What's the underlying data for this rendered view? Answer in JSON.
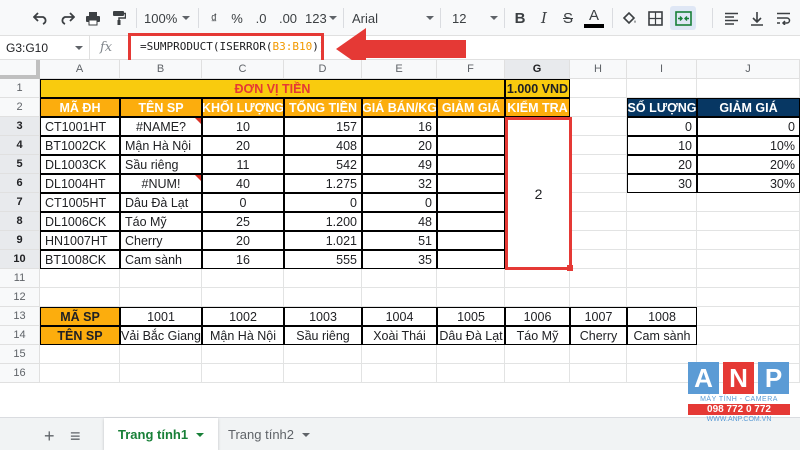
{
  "toolbar": {
    "zoom": "100%",
    "currency": "₫",
    "percent": "%",
    "dec_decrease": ".0",
    "dec_increase": ".00",
    "more_formats": "123",
    "font": "Arial",
    "font_size": "12",
    "bold": "B",
    "italic": "I",
    "strike": "S",
    "text_color": "A"
  },
  "formula_bar": {
    "name_box": "G3:G10",
    "fx": "fx",
    "formula_prefix": "=SUMPRODUCT(ISERROR(",
    "formula_ref": "B3:B10",
    "formula_suffix": "))"
  },
  "columns": [
    "A",
    "B",
    "C",
    "D",
    "E",
    "F",
    "G",
    "H",
    "I",
    "J"
  ],
  "rows": [
    "1",
    "2",
    "3",
    "4",
    "5",
    "6",
    "7",
    "8",
    "9",
    "10",
    "11",
    "12",
    "13",
    "14",
    "15",
    "16"
  ],
  "title": {
    "label": "ĐƠN VỊ TIỀN",
    "unit": "1.000 VND"
  },
  "headers": [
    "MÃ ĐH",
    "TÊN SP",
    "KHỐI LƯỢNG",
    "TỔNG TIỀN",
    "GIÁ BÁN/KG",
    "GIẢM GIÁ",
    "KIỂM TRA"
  ],
  "orders": [
    [
      "CT1001HT",
      "#NAME?",
      "10",
      "157",
      "16",
      ""
    ],
    [
      "BT1002CK",
      "Mận Hà Nội",
      "20",
      "408",
      "20",
      ""
    ],
    [
      "DL1003CK",
      "Sầu riêng",
      "11",
      "542",
      "49",
      ""
    ],
    [
      "DL1004HT",
      "#NUM!",
      "40",
      "1.275",
      "32",
      ""
    ],
    [
      "CT1005HT",
      "Dâu Đà Lạt",
      "0",
      "0",
      "0",
      ""
    ],
    [
      "DL1006CK",
      "Táo Mỹ",
      "25",
      "1.200",
      "48",
      ""
    ],
    [
      "HN1007HT",
      "Cherry",
      "20",
      "1.021",
      "51",
      ""
    ],
    [
      "BT1008CK",
      "Cam sành",
      "16",
      "555",
      "35",
      ""
    ]
  ],
  "result": "2",
  "discount": {
    "headers": [
      "SỐ LƯỢNG",
      "GIẢM GIÁ"
    ],
    "rows": [
      [
        "0",
        "0"
      ],
      [
        "10",
        "10%"
      ],
      [
        "20",
        "20%"
      ],
      [
        "30",
        "30%"
      ]
    ]
  },
  "products": {
    "code_label": "MÃ SP",
    "name_label": "TÊN SP",
    "codes": [
      "1001",
      "1002",
      "1003",
      "1004",
      "1005",
      "1006",
      "1007",
      "1008"
    ],
    "names": [
      "Vải Bắc Giang",
      "Mận Hà Nội",
      "Sầu riêng",
      "Xoài Thái",
      "Dâu Đà Lạt",
      "Táo Mỹ",
      "Cherry",
      "Cam sành"
    ]
  },
  "sheets": {
    "add": "+",
    "list": "≡",
    "tabs": [
      "Trang tính1",
      "Trang tính2"
    ]
  },
  "logo": {
    "letters": [
      "A",
      "N",
      "P"
    ],
    "line1": "MÁY TÍNH - CAMERA",
    "phone": "098 772 0 772",
    "website": "WWW.ANP.COM.VN"
  },
  "colors": {
    "title_yellow": "#f9cb0e",
    "header_orange": "#fcad0d",
    "discount_navy": "#073763",
    "highlight_red": "#e53935"
  }
}
